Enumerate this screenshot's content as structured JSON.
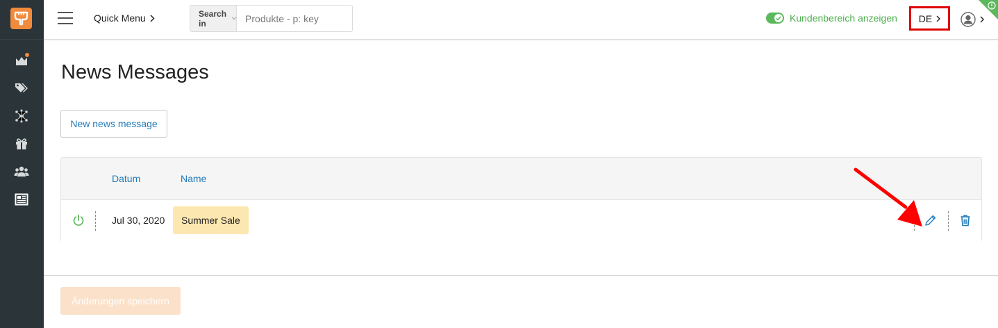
{
  "topbar": {
    "quick_menu_label": "Quick Menu",
    "search_in_label": "Search in",
    "search_placeholder": "Produkte - p: key",
    "customer_area_label": "Kundenbereich anzeigen",
    "language_label": "DE"
  },
  "page": {
    "title": "News Messages",
    "new_button_label": "New news message",
    "save_button_label": "Änderungen speichern"
  },
  "table": {
    "columns": [
      "Datum",
      "Name"
    ],
    "rows": [
      {
        "date": "Jul 30, 2020",
        "name": "Summer Sale",
        "active": true
      }
    ]
  },
  "colors": {
    "sidebar_bg": "#2b3438",
    "brand_orange": "#f08a3c",
    "link_blue": "#1f7ab8",
    "success_green": "#5cb85c",
    "highlight_red": "#e00000",
    "name_badge_bg": "#fde7b0"
  },
  "icons": {
    "sidebar": [
      "dashboard-icon",
      "tags-icon",
      "network-icon",
      "gift-icon",
      "users-icon",
      "newspaper-icon"
    ],
    "row_actions": [
      "power-icon",
      "pencil-icon",
      "trash-icon"
    ]
  }
}
